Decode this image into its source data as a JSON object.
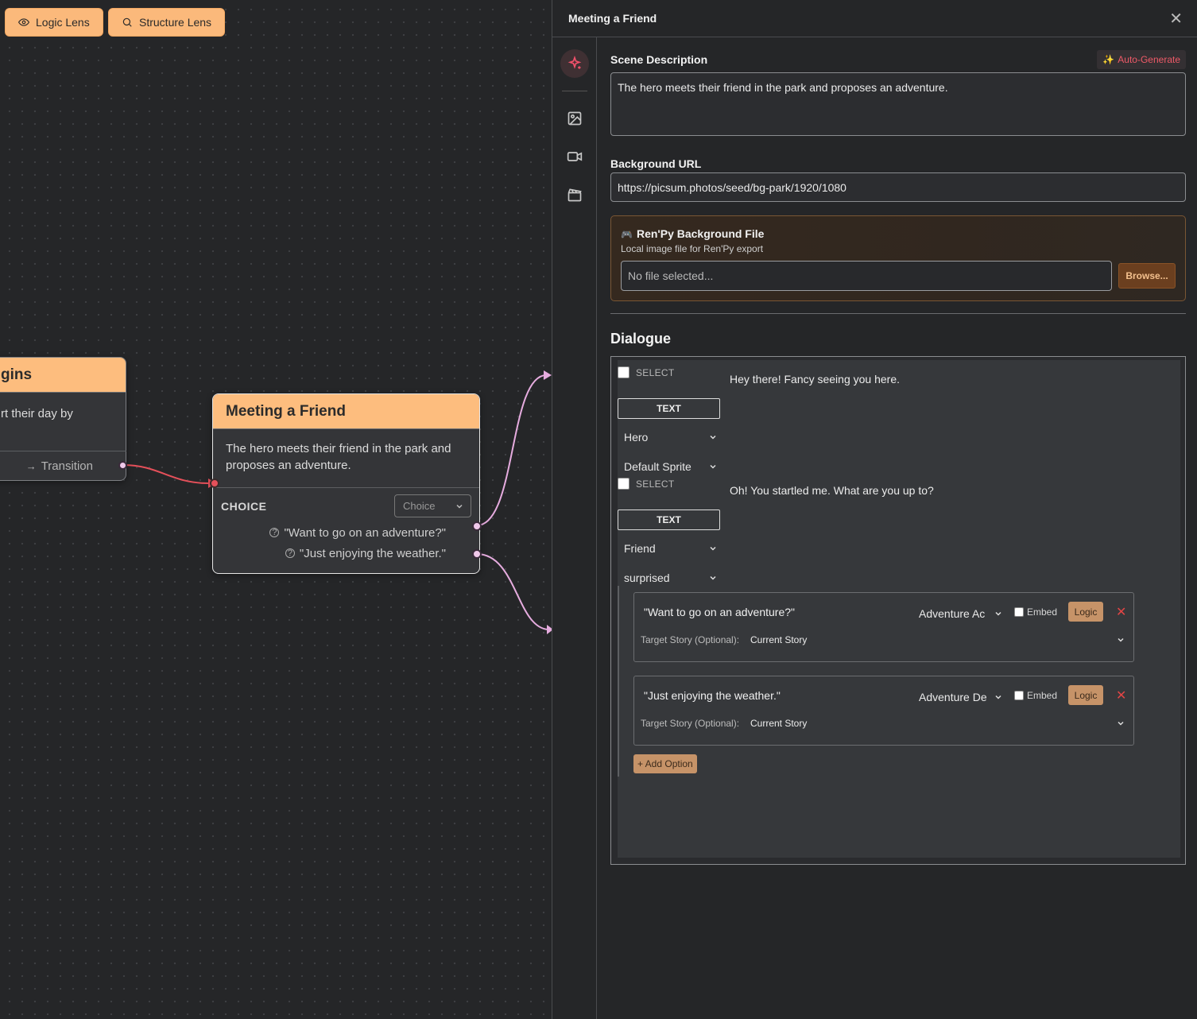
{
  "canvas": {
    "logic_lens_label": "Logic Lens",
    "structure_lens_label": "Structure Lens",
    "prev_node": {
      "title_fragment": "gins",
      "body_fragment": "rt their day by",
      "transition_label": "Transition"
    },
    "node": {
      "title": "Meeting a Friend",
      "description": "The hero meets their friend in the park and proposes an adventure.",
      "choice_label": "CHOICE",
      "choice_select_value": "Choice",
      "options": [
        "\"Want to go on an adventure?\"",
        "\"Just enjoying the weather.\""
      ]
    },
    "colors": {
      "node_header": "#fdbd7e",
      "edge_in": "#e5505a",
      "edge_out": "#e6acdf"
    }
  },
  "panel": {
    "title": "Meeting a Friend",
    "close_icon": "x-icon",
    "rail_icons": [
      "sparkle-icon",
      "image-icon",
      "video-icon",
      "clapperboard-icon"
    ],
    "scene_description_label": "Scene Description",
    "auto_generate_label": "Auto-Generate",
    "scene_description_value": "The hero meets their friend in the park and proposes an adventure.",
    "background_url_label": "Background URL",
    "background_url_value": "https://picsum.photos/seed/bg-park/1920/1080",
    "renpy": {
      "title": "Ren'Py Background File",
      "subtitle": "Local image file for Ren'Py export",
      "file_placeholder": "No file selected...",
      "browse_label": "Browse..."
    },
    "dialogue_title": "Dialogue",
    "lines": [
      {
        "select_label": "SELECT",
        "type_label": "TEXT",
        "speaker": "Hero",
        "sprite": "Default Sprite",
        "text": "Hey there! Fancy seeing you here."
      },
      {
        "select_label": "SELECT",
        "type_label": "TEXT",
        "speaker": "Friend",
        "sprite": "surprised",
        "text": "Oh! You startled me. What are you up to?"
      }
    ],
    "options": [
      {
        "text": "\"Want to go on an adventure?\"",
        "target": "Adventure Accepted",
        "target_visible": "Adventure Ac",
        "embed_label": "Embed",
        "logic_label": "Logic",
        "target_story_label": "Target Story (Optional):",
        "target_story_value": "Current Story"
      },
      {
        "text": "\"Just enjoying the weather.\"",
        "target": "Adventure Declined",
        "target_visible": "Adventure De",
        "embed_label": "Embed",
        "logic_label": "Logic",
        "target_story_label": "Target Story (Optional):",
        "target_story_value": "Current Story"
      }
    ],
    "add_option_label": "+ Add Option"
  }
}
